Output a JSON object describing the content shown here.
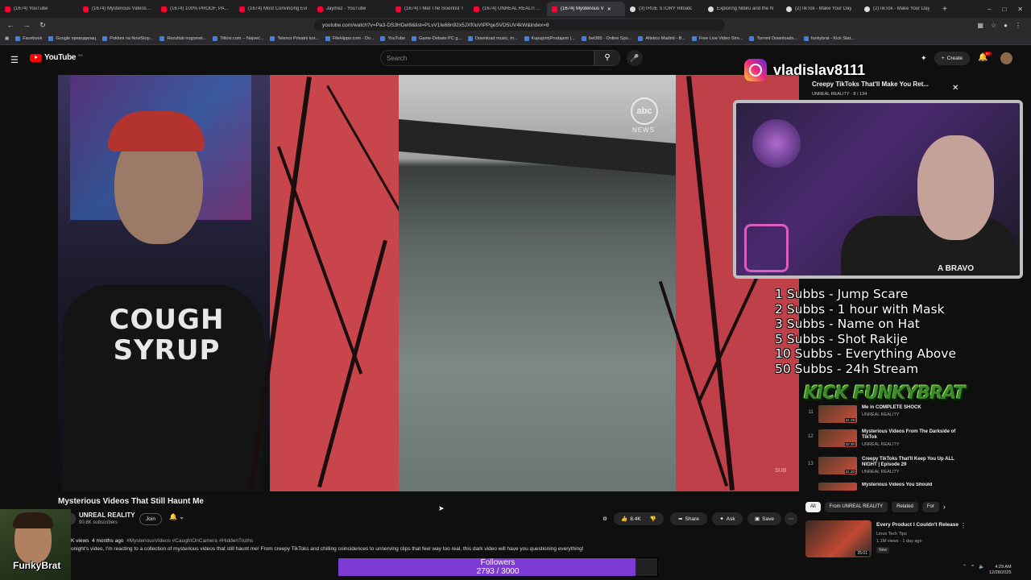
{
  "browser": {
    "tabs": [
      {
        "label": "(1674) YouTube",
        "active": false
      },
      {
        "label": "(1674) Mysterious Videos Th",
        "active": false
      },
      {
        "label": "(1674) 100% PROOF, PARA",
        "active": false
      },
      {
        "label": "(1674) Most Convincing Evi",
        "active": false
      },
      {
        "label": "Jaymez - YouTube",
        "active": false
      },
      {
        "label": "(1674) I Met The Scientist T",
        "active": false
      },
      {
        "label": "(1674) UNREAL REALITY - Y",
        "active": false
      },
      {
        "label": "(1674) Mysterious V",
        "active": true
      },
      {
        "label": "(3)TRUE STORY Ritoatc",
        "active": false
      },
      {
        "label": "Exploring Nibiru and the N",
        "active": false
      },
      {
        "label": "(2)TikTok - Make Your Day",
        "active": false
      },
      {
        "label": "(2)TikTok - Make Your Day",
        "active": false
      }
    ],
    "url": "youtube.com/watch?v=Pa3-DS3HDel8&list=PLvV1Ie68n92x5JXf0uVtPPqeSVD5UV4kW&index=8",
    "bookmarks": [
      "Facebook",
      "Google преводилац",
      "Pokloni na NoviStop...",
      "Rezultati nogomet...",
      "Titlovi.com -- Najveć...",
      "Telenor Privatni kor...",
      "FileHippo.com - Do...",
      "YouTube",
      "Game-Debate PC g...",
      "Download music, m...",
      "Kupujem|Prodajem |...",
      "bet365 - Online Spo...",
      "Atletico Madrid - B...",
      "Free Live Video Stre...",
      "Torrent Downloads...",
      "funkybrat - Kick Stat..."
    ]
  },
  "header": {
    "logo_text": "YouTube",
    "country": "RS",
    "search_placeholder": "Search",
    "create_label": "Create",
    "bell_badge": "9+"
  },
  "video": {
    "shirt_text": "COUGH SYRUP",
    "watermark": "abc",
    "watermark_sub": "NEWS",
    "corner_mark": "SUB",
    "title": "Mysterious Videos That Still Haunt Me",
    "channel": "UNREAL REALITY",
    "subscribers": "90.8K subscribers",
    "join_label": "Join",
    "likes": "8.4K",
    "share_label": "Share",
    "ask_label": "Ask",
    "save_label": "Save",
    "views": "K views",
    "age": "4 months ago",
    "hashtags": "#MysteriousVideos #CaughtOnCamera #HiddenTruths",
    "description": "onight's video, I'm reacting to a collection of mysterious videos that still haunt me! From creepy TikToks and chilling coincidences to unnerving clips that feel way too real, this dark video will have you questioning everything!"
  },
  "playlist": {
    "title": "Creepy TikToks That'll Make You Ret...",
    "channel": "UNREAL REALITY",
    "position": "8 / 134",
    "items": [
      {
        "index": "11",
        "title": "Me in COMPLETE SHOCK",
        "channel": "UNREAL REALITY",
        "duration": "31:29"
      },
      {
        "index": "12",
        "title": "Mysterious Videos From The Darkside of TikTok",
        "channel": "UNREAL REALITY",
        "duration": "32:30"
      },
      {
        "index": "13",
        "title": "Creepy TikToks That'll Keep You Up ALL NIGHT | Episode 29",
        "channel": "UNREAL REALITY",
        "duration": "31:20"
      },
      {
        "index": "",
        "title": "Mysterious Videos You Should",
        "channel": "",
        "duration": ""
      }
    ]
  },
  "chips": [
    "All",
    "From UNREAL REALITY",
    "Related",
    "For"
  ],
  "recommended": {
    "title": "Every Product I Couldn't Release",
    "channel": "Linus Tech Tips",
    "meta": "1.1M views · 1 day ago",
    "badge": "New",
    "duration": "25:01"
  },
  "overlay": {
    "instagram_handle": "vladislav8111",
    "webcam_text": "A BRAVO",
    "sub_goals": [
      "1 Subbs - Jump Scare",
      "2 Subbs - 1 hour with Mask",
      "3 Subbs - Name on Hat",
      "5 Subbs - Shot Rakije",
      "10 Subbs - Everything Above",
      "50 Subbs - 24h Stream"
    ],
    "brand": "KICK FUNKYBRAT",
    "streamer_name": "FunkyBrat",
    "followers_label": "Followers",
    "followers_count": "2793 / 3000",
    "followers_current": 2793,
    "followers_goal": 3000
  },
  "system": {
    "time": "4:29 AM",
    "date": "12/28/2025"
  }
}
